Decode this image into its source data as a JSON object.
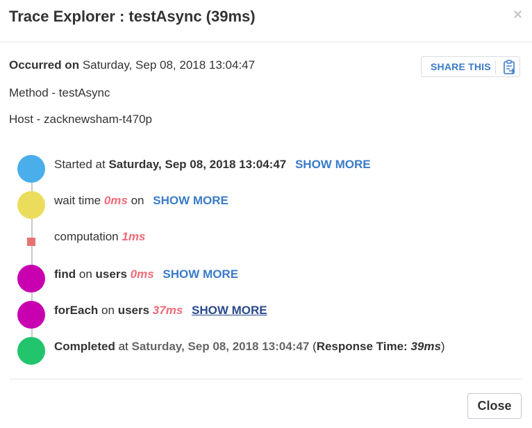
{
  "modal": {
    "title": "Trace Explorer : testAsync (39ms)",
    "close_glyph": "×"
  },
  "info": {
    "occurred_label": "Occurred on",
    "occurred_value": "Saturday, Sep 08, 2018 13:04:47",
    "method": "Method - testAsync",
    "host": "Host - zacknewsham-t470p"
  },
  "share": {
    "label": "SHARE THIS",
    "icon": "clipboard-share-icon"
  },
  "timeline": {
    "colors": {
      "start": "#4aaeea",
      "wait": "#ebdc5c",
      "compute": "#e57373",
      "db": "#c800b0",
      "end": "#22c46c",
      "ms": "#f06a78",
      "link": "#3a7bc8"
    },
    "started": {
      "prefix": "Started at",
      "time": "Saturday, Sep 08, 2018 13:04:47",
      "link": "SHOW MORE"
    },
    "wait": {
      "prefix": "wait time",
      "ms": "0ms",
      "suffix": "on",
      "link": "SHOW MORE"
    },
    "computation": {
      "prefix": "computation",
      "ms": "1ms"
    },
    "find": {
      "op": "find",
      "mid": "on",
      "collection": "users",
      "ms": "0ms",
      "link": "SHOW MORE"
    },
    "foreach": {
      "op": "forEach",
      "mid": "on",
      "collection": "users",
      "ms": "37ms",
      "link": "SHOW MORE"
    },
    "completed": {
      "label": "Completed",
      "mid": "at",
      "time": "Saturday, Sep 08, 2018 13:04:47",
      "open": "(",
      "rt_label": "Response Time:",
      "rt_value": "39ms",
      "close": ")"
    }
  },
  "footer": {
    "close_label": "Close"
  }
}
